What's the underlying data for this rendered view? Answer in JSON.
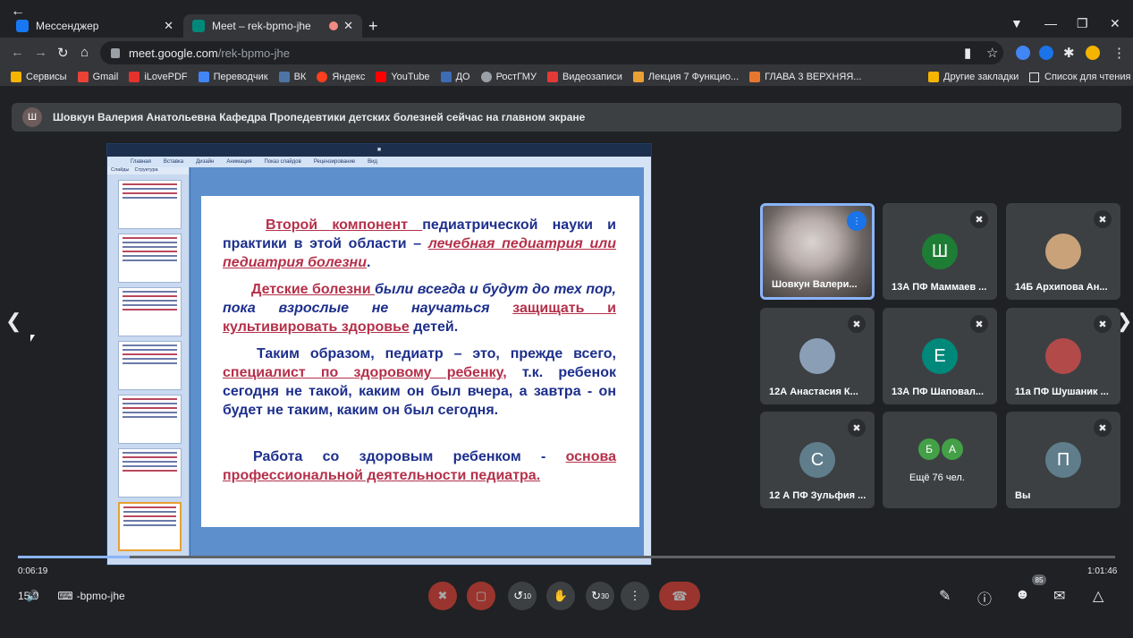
{
  "browser": {
    "tabs": [
      {
        "title": "Мессенджер",
        "favicon_color": "#1877f2"
      },
      {
        "title": "Meet – rek-bpmo-jhe",
        "favicon_color": "#00897b",
        "recording": true
      }
    ],
    "url_host": "meet.google.com",
    "url_path": "/rek-bpmo-jhe"
  },
  "bookmarks": [
    {
      "label": "Сервисы",
      "color": "#f4b400"
    },
    {
      "label": "Gmail",
      "color": "#ea4335"
    },
    {
      "label": "iLovePDF",
      "color": "#e5322d"
    },
    {
      "label": "Переводчик",
      "color": "#4285f4"
    },
    {
      "label": "ВК",
      "color": "#4c75a3"
    },
    {
      "label": "Яндекс",
      "color": "#fc3f1d"
    },
    {
      "label": "YouTube",
      "color": "#ff0000"
    },
    {
      "label": "ДО",
      "color": "#3d6cb3"
    },
    {
      "label": "РостГМУ",
      "color": "#9aa0a6"
    },
    {
      "label": "Видеозаписи",
      "color": "#e53935"
    },
    {
      "label": "Лекция 7 Функцио...",
      "color": "#e8a033"
    },
    {
      "label": "ГЛАВА 3 ВЕРХНЯЯ...",
      "color": "#e8772e"
    }
  ],
  "bookmarks_right": {
    "other": "Другие закладки",
    "reading_list": "Список для чтения"
  },
  "banner": {
    "avatar_letter": "Ш",
    "text": "Шовкун Валерия Анатольевна Кафедра Пропедевтики детских болезней сейчас на главном экране"
  },
  "slide": {
    "p1_red": "Второй компонент ",
    "p1_text": "педиатрической науки и практики в этой области – ",
    "p1_redi": "лечебная педиатрия или педиатрия болезни",
    "p1_end": ".",
    "p2_red": "Детские болезни ",
    "p2_italic": "были всегда и будут до тех пор, пока взрослые не научаться ",
    "p2_red2": "защищать и культивировать здоровье",
    "p2_end": " детей.",
    "p3_a": "Таким образом, педиатр – это, прежде всего, ",
    "p3_red": "специалист по здоровому ребенку,",
    "p3_b": " т.к. ребенок сегодня не такой, каким он был вчера, а завтра - он будет не таким, каким он был сегодня.",
    "p4_a": "Работа со здоровым ребенком - ",
    "p4_red": "основа профессиональной деятельности педиатра."
  },
  "ppt": {
    "ribbon_tabs": [
      "Главная",
      "Вставка",
      "Дизайн",
      "Анимация",
      "Показ слайдов",
      "Рецензирование",
      "Вид"
    ],
    "side_tabs": [
      "Слайды",
      "Структура"
    ]
  },
  "participants": [
    {
      "name": "Шовкун Валери...",
      "type": "video",
      "active": true
    },
    {
      "name": "13А ПФ Маммаев ...",
      "letter": "Ш",
      "color": "#1e7d34",
      "muted": true
    },
    {
      "name": "14Б Архипова Ан...",
      "type": "photo",
      "color": "#c9a27a",
      "muted": true
    },
    {
      "name": "12А Анастасия К...",
      "type": "photo",
      "color": "#8a9fb5",
      "muted": true
    },
    {
      "name": "13А ПФ Шаповал...",
      "letter": "Е",
      "color": "#00897b",
      "muted": true
    },
    {
      "name": "11а ПФ Шушаник ...",
      "type": "photo",
      "color": "#b34a4a",
      "muted": true
    },
    {
      "name": "12 А ПФ Зульфия ...",
      "letter": "С",
      "color": "#607d8b",
      "muted": true
    },
    {
      "name": "Ещё 76 чел.",
      "letters": [
        "Б",
        "А"
      ],
      "colors": [
        "#43a047",
        "#43a047"
      ]
    },
    {
      "name": "Вы",
      "letter": "П",
      "color": "#607d8b",
      "muted": true
    }
  ],
  "player": {
    "elapsed": "0:06:19",
    "total": "1:01:46",
    "progress_fraction": 0.102
  },
  "bottom": {
    "clock_partial": "15:0",
    "meeting_code": "-bpmo-jhe",
    "participants_count": "85",
    "rewind_label": "10",
    "forward_label": "30"
  }
}
